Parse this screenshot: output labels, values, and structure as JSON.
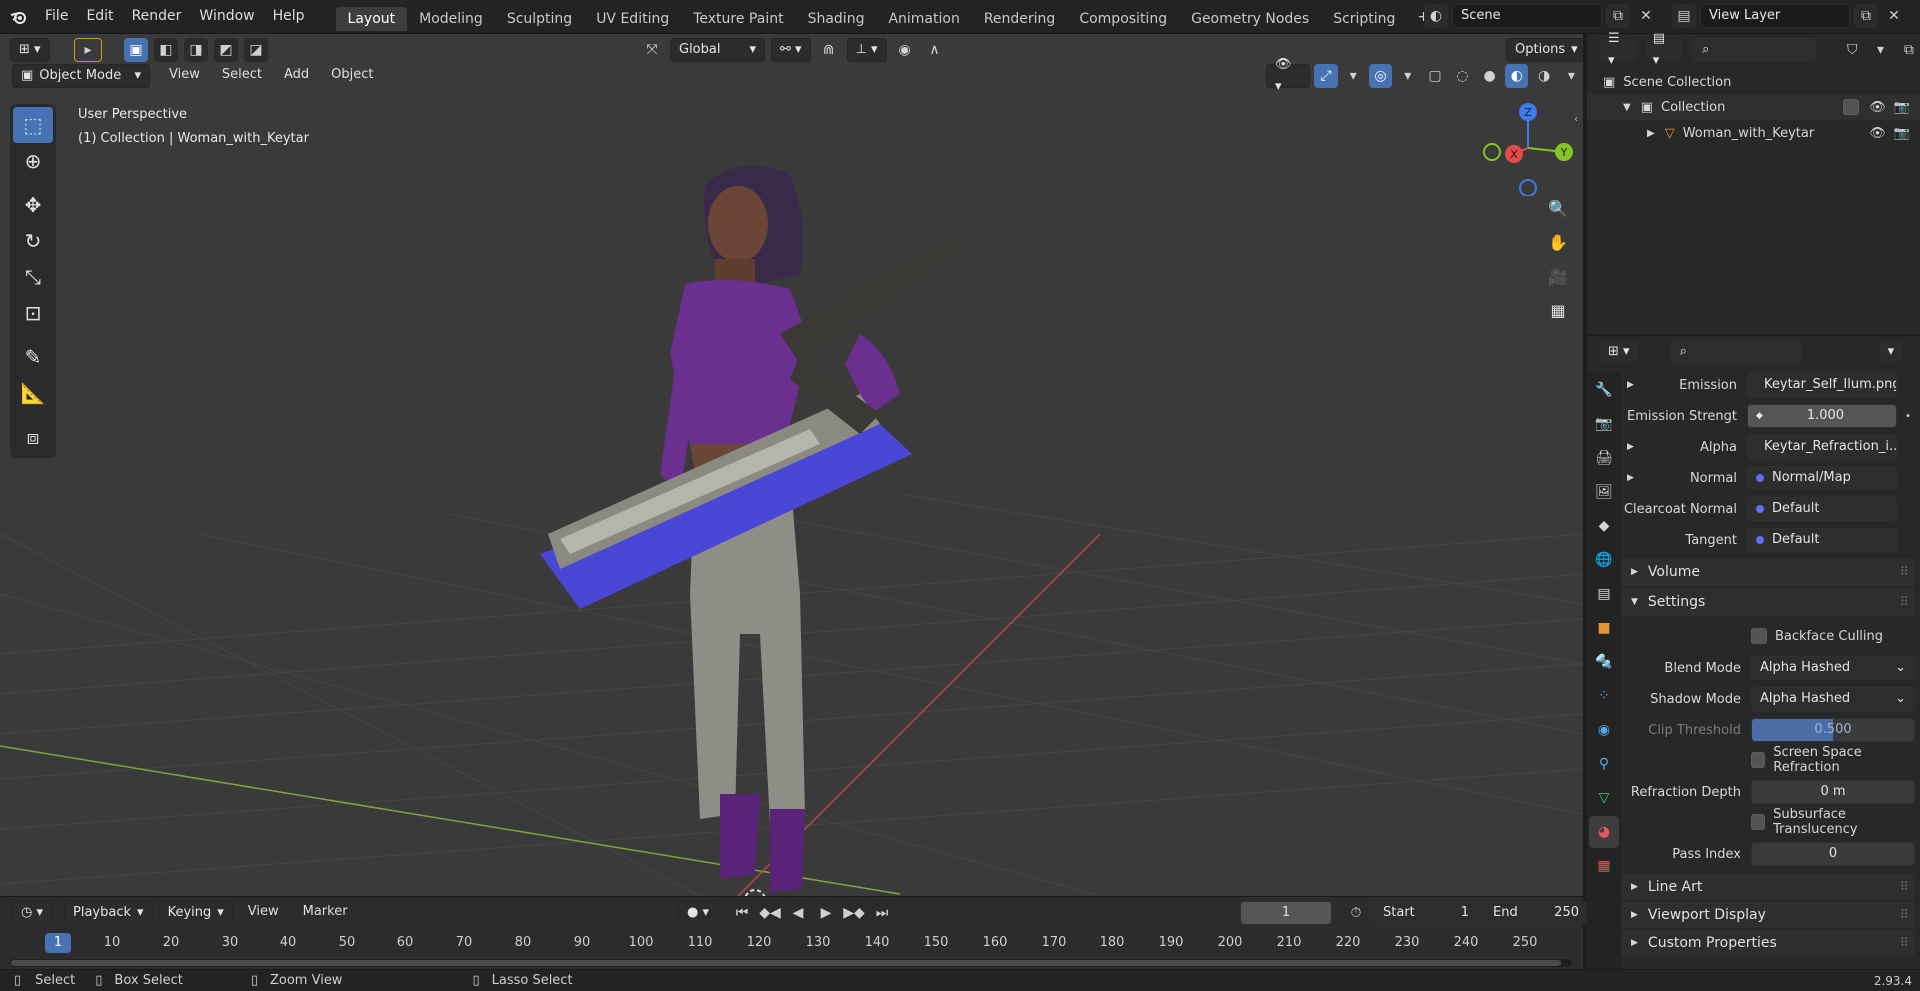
{
  "menu": [
    "File",
    "Edit",
    "Render",
    "Window",
    "Help"
  ],
  "workspaces": [
    "Layout",
    "Modeling",
    "Sculpting",
    "UV Editing",
    "Texture Paint",
    "Shading",
    "Animation",
    "Rendering",
    "Compositing",
    "Geometry Nodes",
    "Scripting"
  ],
  "active_workspace": "Layout",
  "scene": "Scene",
  "view_layer": "View Layer",
  "viewport": {
    "mode": "Object Mode",
    "menus": [
      "View",
      "Select",
      "Add",
      "Object"
    ],
    "orientation": "Global",
    "options": "Options",
    "overlay_title": "User Perspective",
    "overlay_subtitle": "(1) Collection | Woman_with_Keytar",
    "gizmo": {
      "z": "Z",
      "x": "X",
      "y": "Y"
    }
  },
  "timeline": {
    "menus": [
      "Playback",
      "Keying",
      "View",
      "Marker"
    ],
    "current_frame": "1",
    "start_label": "Start",
    "start": "1",
    "end_label": "End",
    "end": "250",
    "ticks": [
      "1",
      "10",
      "20",
      "30",
      "40",
      "50",
      "60",
      "70",
      "80",
      "90",
      "100",
      "110",
      "120",
      "130",
      "140",
      "150",
      "160",
      "170",
      "180",
      "190",
      "200",
      "210",
      "220",
      "230",
      "240",
      "250"
    ]
  },
  "status": {
    "select": "Select",
    "box_select": "Box Select",
    "zoom_view": "Zoom View",
    "lasso_select": "Lasso Select",
    "version": "2.93.4"
  },
  "outliner": {
    "scene_collection": "Scene Collection",
    "collection": "Collection",
    "object": "Woman_with_Keytar"
  },
  "properties": {
    "inputs": [
      {
        "label": "Emission",
        "value": "Keytar_Self_Ilum.png",
        "dot": "#d8d83a"
      },
      {
        "label": "Emission Strengt",
        "value": "1.000"
      },
      {
        "label": "Alpha",
        "value": "Keytar_Refraction_i...",
        "dot": "#c9c9c9"
      },
      {
        "label": "Normal",
        "value": "Normal/Map",
        "dot": "#6a6af0"
      },
      {
        "label": "Clearcoat Normal",
        "value": "Default",
        "dot": "#6a6af0"
      },
      {
        "label": "Tangent",
        "value": "Default",
        "dot": "#6a6af0"
      }
    ],
    "volume": "Volume",
    "settings": "Settings",
    "backface_culling": "Backface Culling",
    "blend_mode_label": "Blend Mode",
    "blend_mode": "Alpha Hashed",
    "shadow_mode_label": "Shadow Mode",
    "shadow_mode": "Alpha Hashed",
    "clip_threshold_label": "Clip Threshold",
    "clip_threshold": "0.500",
    "screen_space_refraction": "Screen Space Refraction",
    "refraction_depth_label": "Refraction Depth",
    "refraction_depth": "0 m",
    "subsurface_translucency": "Subsurface Translucency",
    "pass_index_label": "Pass Index",
    "pass_index": "0",
    "line_art": "Line Art",
    "viewport_display": "Viewport Display",
    "custom_properties": "Custom Properties"
  },
  "colors": {
    "accent": "#4772b3",
    "x_axis": "#e34a4a",
    "y_axis": "#84c426",
    "z_axis": "#3d7be6"
  }
}
